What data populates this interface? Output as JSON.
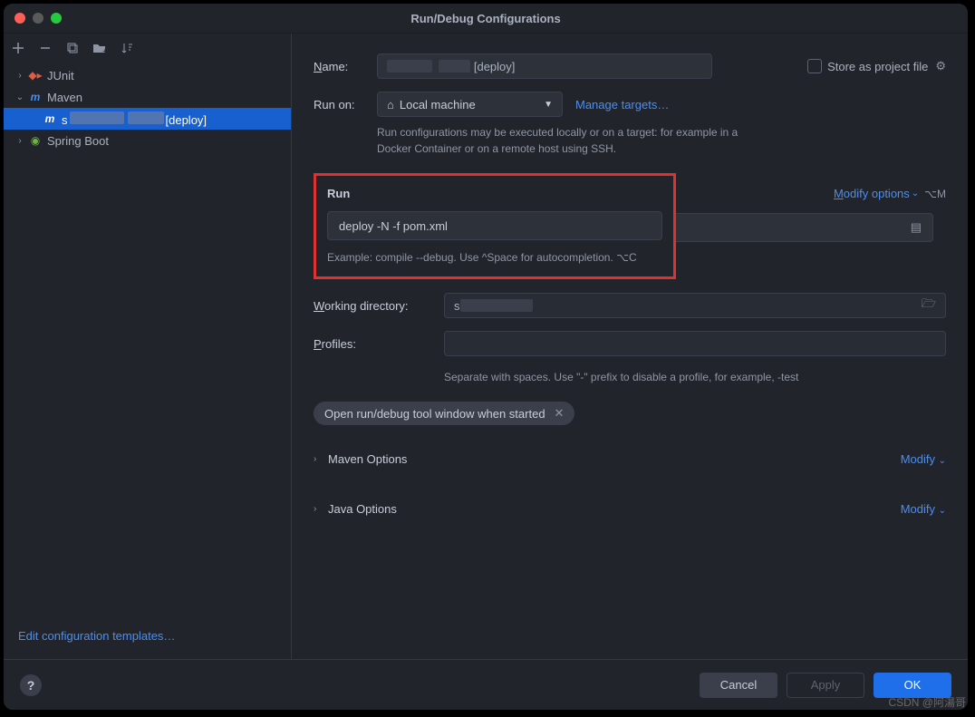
{
  "title": "Run/Debug Configurations",
  "sidebar": {
    "items": [
      {
        "label": "JUnit",
        "expanded": false,
        "icon_color": "#e05a48"
      },
      {
        "label": "Maven",
        "expanded": true,
        "icon_char": "m",
        "icon_color": "#4b8ef1"
      },
      {
        "label_prefix": "s",
        "label_suffix": "[deploy]",
        "icon_char": "m",
        "icon_color": "#fff",
        "selected": true
      },
      {
        "label": "Spring Boot",
        "expanded": false,
        "icon_color": "#6db33f"
      }
    ],
    "edit_templates": "Edit configuration templates…"
  },
  "form": {
    "name_label": "Name:",
    "name_value_suffix": "[deploy]",
    "store_label": "Store as project file",
    "run_on_label": "Run on:",
    "run_on_value": "Local machine",
    "manage_targets": "Manage targets…",
    "run_on_hint": "Run configurations may be executed locally or on a target: for example in a Docker Container or on a remote host using SSH.",
    "run_section": "Run",
    "modify_options": "Modify options",
    "modify_shortcut": "⌥M",
    "command_value": "deploy -N -f pom.xml",
    "command_hint": "Example: compile --debug. Use ^Space for autocompletion. ⌥C",
    "working_dir_label": "Working directory:",
    "working_dir_value_prefix": "s",
    "profiles_label": "Profiles:",
    "profiles_hint": "Separate with spaces. Use \"-\" prefix to disable a profile, for example, -test",
    "chip_label": "Open run/debug tool window when started",
    "maven_options": "Maven Options",
    "java_options": "Java Options",
    "modify": "Modify"
  },
  "footer": {
    "cancel": "Cancel",
    "apply": "Apply",
    "ok": "OK"
  },
  "watermark": "CSDN @阿湯哥"
}
